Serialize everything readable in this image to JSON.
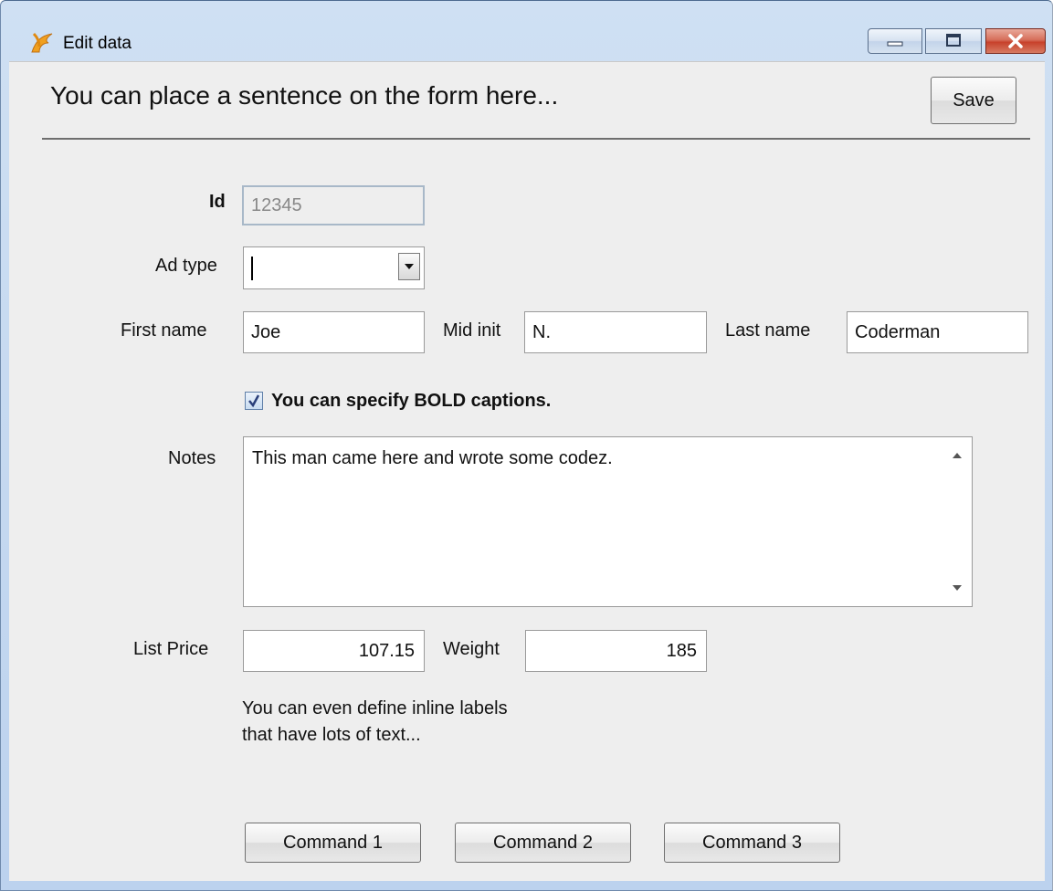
{
  "window": {
    "title": "Edit data",
    "controls": {
      "minimize_icon": "minimize-icon",
      "maximize_icon": "maximize-icon",
      "close_icon": "close-icon"
    }
  },
  "header": {
    "text": "You can place a sentence on the form here...",
    "save_label": "Save"
  },
  "form": {
    "id": {
      "label": "Id",
      "value": "12345"
    },
    "ad_type": {
      "label": "Ad type",
      "value": ""
    },
    "first_name": {
      "label": "First name",
      "value": "Joe"
    },
    "mid_init": {
      "label": "Mid init",
      "value": "N."
    },
    "last_name": {
      "label": "Last name",
      "value": "Coderman"
    },
    "bold_checkbox": {
      "label": "You can specify BOLD captions.",
      "checked": true
    },
    "notes": {
      "label": "Notes",
      "value": "This man came here and wrote some codez."
    },
    "list_price": {
      "label": "List Price",
      "value": "107.15"
    },
    "weight": {
      "label": "Weight",
      "value": "185"
    },
    "inline_label": {
      "line1": "You can even define inline labels",
      "line2": "that have lots of text..."
    }
  },
  "commands": {
    "command1": "Command 1",
    "command2": "Command 2",
    "command3": "Command 3"
  },
  "colors": {
    "window_frame": "#bcd2ee",
    "client_bg": "#eeeeee",
    "close_button": "#c7412b",
    "disabled_field_border": "#a8b8c8"
  }
}
